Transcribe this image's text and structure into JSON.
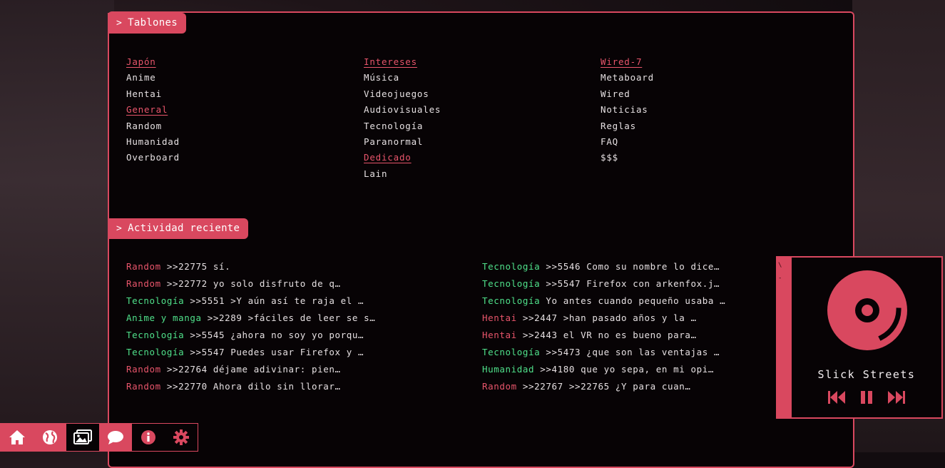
{
  "boards_section": {
    "title": "Tablones"
  },
  "boards": {
    "col1": [
      {
        "label": "Japón",
        "type": "category"
      },
      {
        "label": "Anime",
        "type": "link"
      },
      {
        "label": "Hentai",
        "type": "link"
      },
      {
        "label": "General",
        "type": "category"
      },
      {
        "label": "Random",
        "type": "link"
      },
      {
        "label": "Humanidad",
        "type": "link"
      },
      {
        "label": "Overboard",
        "type": "link"
      }
    ],
    "col2": [
      {
        "label": "Intereses",
        "type": "category"
      },
      {
        "label": "Música",
        "type": "link"
      },
      {
        "label": "Videojuegos",
        "type": "link"
      },
      {
        "label": "Audiovisuales",
        "type": "link"
      },
      {
        "label": "Tecnología",
        "type": "link"
      },
      {
        "label": "Paranormal",
        "type": "link"
      },
      {
        "label": "Dedicado",
        "type": "category"
      },
      {
        "label": "Lain",
        "type": "link"
      }
    ],
    "col3": [
      {
        "label": "Wired-7",
        "type": "category"
      },
      {
        "label": "Metaboard",
        "type": "link"
      },
      {
        "label": "Wired",
        "type": "link"
      },
      {
        "label": "Noticias",
        "type": "link"
      },
      {
        "label": "Reglas",
        "type": "link"
      },
      {
        "label": "FAQ",
        "type": "link"
      },
      {
        "label": "$$$",
        "type": "link"
      }
    ]
  },
  "activity_section": {
    "title": "Actividad reciente"
  },
  "activity": {
    "left": [
      {
        "board": "Random",
        "color": "red",
        "text": " >>22775 sí."
      },
      {
        "board": "Random",
        "color": "red",
        "text": " >>22772 yo solo disfruto de q…"
      },
      {
        "board": "Tecnología",
        "color": "green",
        "text": " >>5551 >Y aún así te raja el …"
      },
      {
        "board": "Anime y manga",
        "color": "green",
        "text": " >>2289 >fáciles de leer se s…"
      },
      {
        "board": "Tecnología",
        "color": "green",
        "text": " >>5545 ¿ahora no soy yo porqu…"
      },
      {
        "board": "Tecnología",
        "color": "green",
        "text": " >>5547 Puedes usar Firefox y …"
      },
      {
        "board": "Random",
        "color": "red",
        "text": " >>22764 déjame adivinar: pien…"
      },
      {
        "board": "Random",
        "color": "red",
        "text": " >>22770 Ahora dilo sin llorar…"
      }
    ],
    "right": [
      {
        "board": "Tecnología",
        "color": "green",
        "text": " >>5546 Como su nombre lo dice…"
      },
      {
        "board": "Tecnología",
        "color": "green",
        "text": " >>5547 Firefox con arkenfox.j…"
      },
      {
        "board": "Tecnología",
        "color": "green",
        "text": " Yo antes cuando pequeño usaba …"
      },
      {
        "board": "Hentai",
        "color": "red",
        "text": " >>2447 >han pasado años y la …"
      },
      {
        "board": "Hentai",
        "color": "red",
        "text": " >>2443 el VR no es bueno para…"
      },
      {
        "board": "Tecnología",
        "color": "green",
        "text": " >>5473 ¿que son las ventajas …"
      },
      {
        "board": "Humanidad",
        "color": "green",
        "text": " >>4180 que yo sepa, en mi opi…"
      },
      {
        "board": "Random",
        "color": "red",
        "text": " >>22767 >>22765 ¿Y para cuan…"
      }
    ]
  },
  "player": {
    "song": "Slick Streets",
    "strip_glyphs": [
      "\\",
      "-"
    ]
  },
  "taskbar": [
    {
      "icon": "home-icon",
      "active": true
    },
    {
      "icon": "globe-icon",
      "active": true
    },
    {
      "icon": "gallery-icon",
      "active": false
    },
    {
      "icon": "chat-icon",
      "active": true
    },
    {
      "icon": "info-icon",
      "active": false
    },
    {
      "icon": "gear-icon",
      "active": false
    }
  ],
  "colors": {
    "accent": "#d9485f",
    "green": "#4fe08a",
    "panel": "#070305"
  }
}
